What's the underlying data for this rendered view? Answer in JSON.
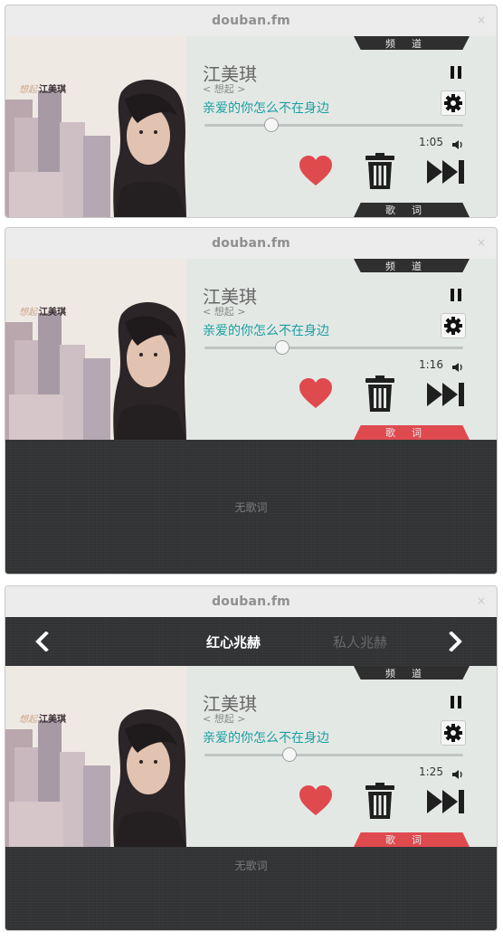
{
  "app": {
    "title": "douban.fm",
    "close_glyph": "×"
  },
  "song": {
    "artist": "江美琪",
    "album": "< 想起 >",
    "title": "亲爱的你怎么不在身边"
  },
  "cover": {
    "name_text": "江美琪",
    "scribble_text": "想起"
  },
  "tabs": {
    "channel": "频道",
    "lyrics": "歌词"
  },
  "lyrics": {
    "empty": "无歌词"
  },
  "channels": {
    "current": "红心兆赫",
    "next": "私人兆赫"
  },
  "icons": [
    "pause-icon",
    "gear-icon",
    "volume-icon",
    "heart-icon",
    "trash-icon",
    "skip-icon",
    "chevron-left-icon",
    "chevron-right-icon"
  ],
  "colors": {
    "accent_red": "#df4a4f",
    "song_teal": "#19a0a0",
    "dark_bar": "#2f2f2f"
  },
  "windows": [
    {
      "time": "1:05",
      "progress": 0.26,
      "lyrics_tab_active": false,
      "show_lyrics": false,
      "show_channels": false
    },
    {
      "time": "1:16",
      "progress": 0.3,
      "lyrics_tab_active": true,
      "show_lyrics": true,
      "show_channels": false
    },
    {
      "time": "1:25",
      "progress": 0.33,
      "lyrics_tab_active": true,
      "show_lyrics": true,
      "show_channels": true
    }
  ]
}
